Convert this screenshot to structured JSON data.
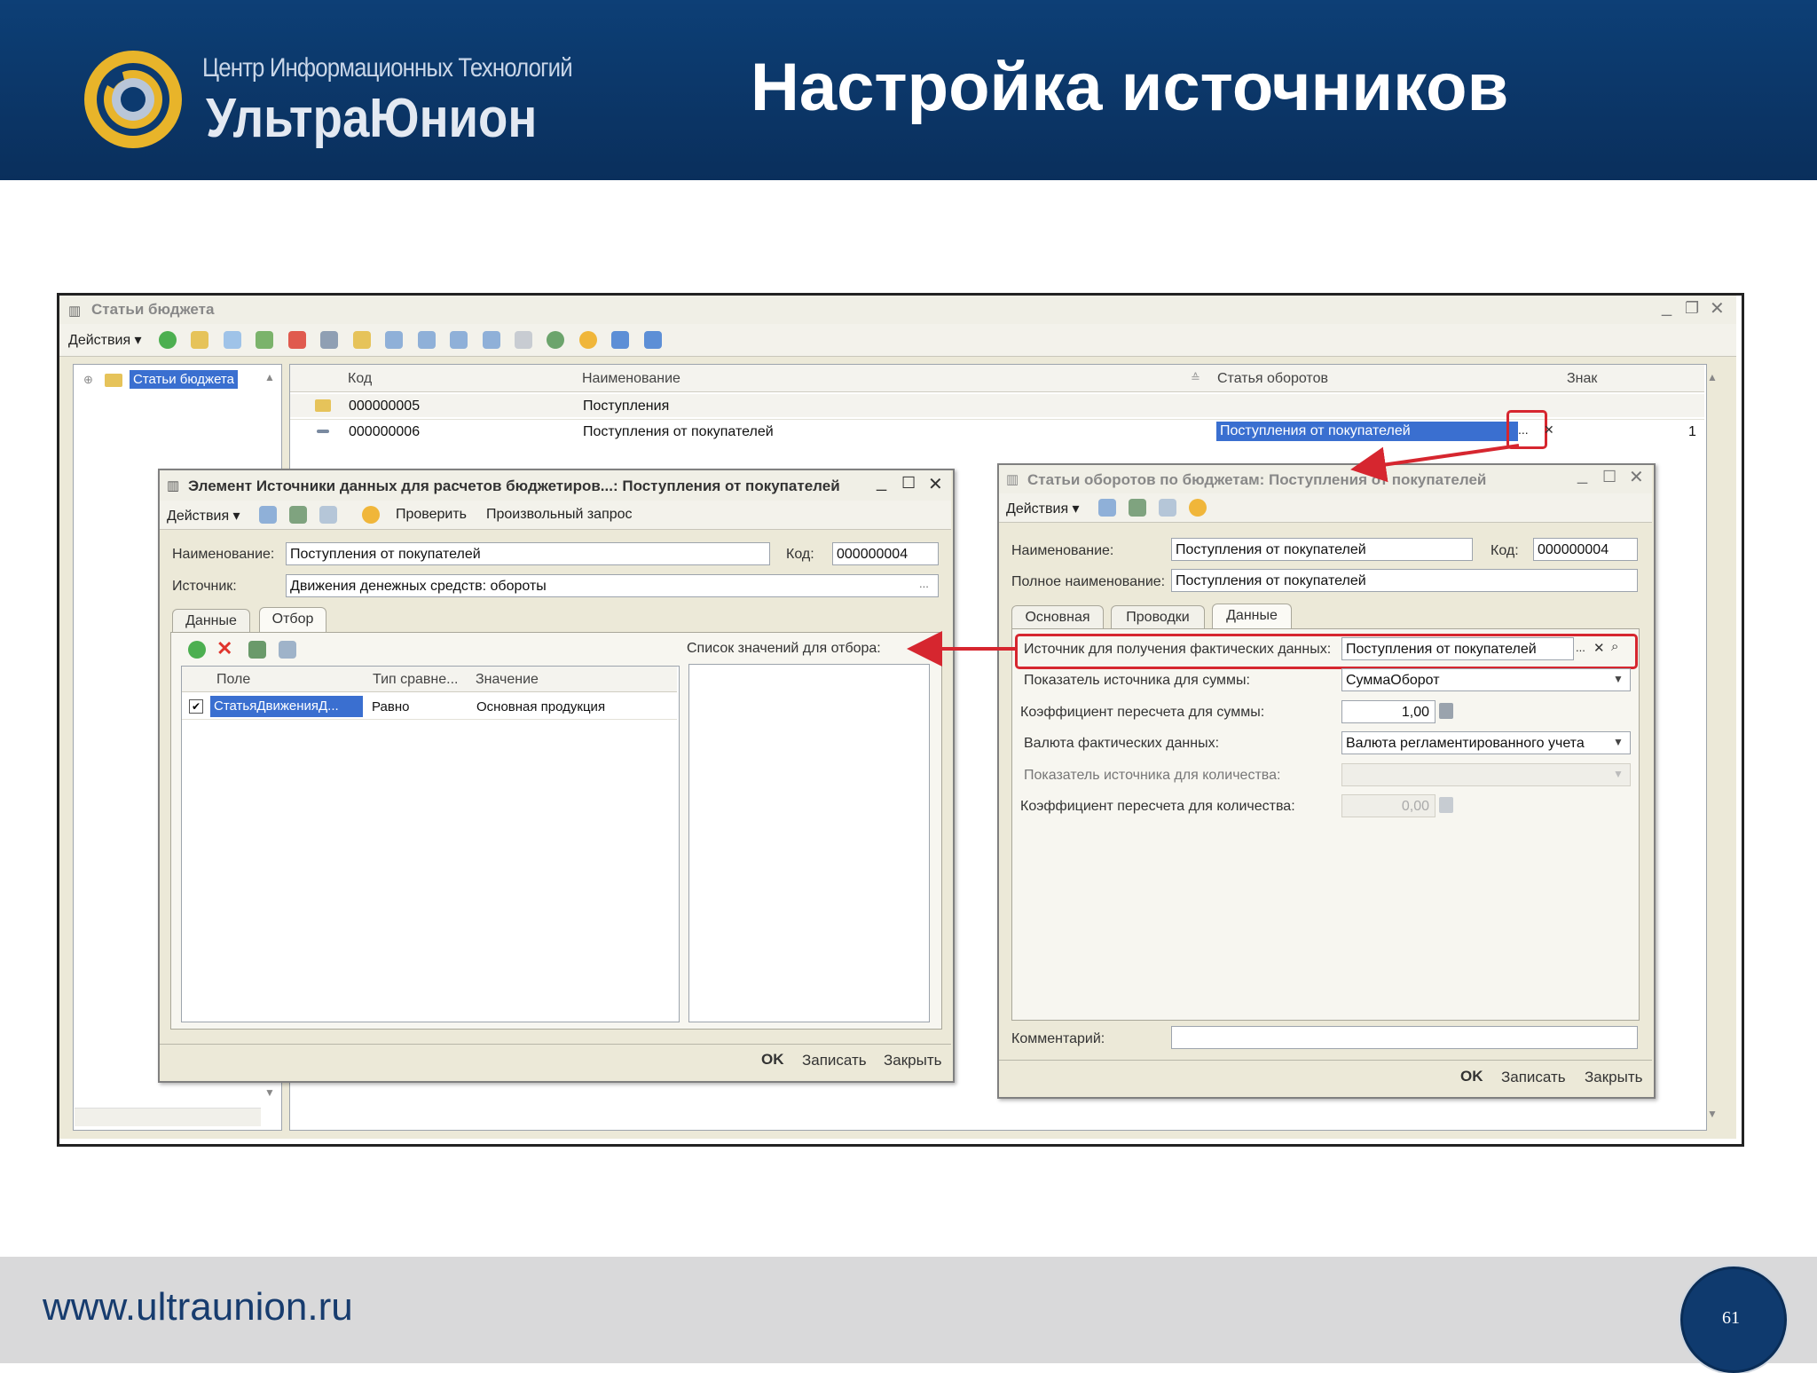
{
  "slide": {
    "logo_line1": "Центр Информационных Технологий",
    "logo_line2": "УльтраЮнион",
    "title": "Настройка источников",
    "footer_url": "www.ultraunion.ru",
    "page_number": "61"
  },
  "colors": {
    "header_bg": "#0d3f76",
    "logo_gold": "#e8b42a",
    "highlight_red": "#d6262f",
    "selection_blue": "#3a6fd0"
  },
  "main_window": {
    "title": "Статьи бюджета",
    "actions_label": "Действия",
    "tree_root": "Статьи бюджета",
    "columns": [
      "Код",
      "Наименование",
      "Статья оборотов",
      "Знак"
    ],
    "rows": [
      {
        "code": "000000005",
        "name": "Поступления",
        "article": "",
        "sign": ""
      },
      {
        "code": "000000006",
        "name": "Поступления от покупателей",
        "article": "Поступления от покупателей",
        "sign": "1"
      }
    ],
    "ellipsis": "..."
  },
  "element_window": {
    "title": "Элемент Источники данных для расчетов бюджетиров...: Поступления от покупателей",
    "actions_label": "Действия",
    "check_label": "Проверить",
    "query_label": "Произвольный запрос",
    "name_label": "Наименование:",
    "name_value": "Поступления от покупателей",
    "code_label": "Код:",
    "code_value": "000000004",
    "source_label": "Источник:",
    "source_value": "Движения денежных средств: обороты",
    "tabs": [
      "Данные",
      "Отбор"
    ],
    "filter_columns": [
      "Поле",
      "Тип сравне...",
      "Значение"
    ],
    "filter_row": {
      "field": "СтатьяДвиженияД...",
      "comparison": "Равно",
      "value": "Основная продукция"
    },
    "values_list_label": "Список значений для отбора:",
    "ok": "OK",
    "save": "Записать",
    "close": "Закрыть"
  },
  "article_window": {
    "title": "Статьи оборотов по бюджетам: Поступления от покупателей",
    "actions_label": "Действия",
    "name_label": "Наименование:",
    "name_value": "Поступления от покупателей",
    "code_label": "Код:",
    "code_value": "000000004",
    "fullname_label": "Полное наименование:",
    "fullname_value": "Поступления от покупателей",
    "tabs": [
      "Основная",
      "Проводки",
      "Данные"
    ],
    "source_label": "Источник для получения фактических данных:",
    "source_value": "Поступления от покупателей",
    "sum_indicator_label": "Показатель источника для суммы:",
    "sum_indicator_value": "СуммаОборот",
    "sum_coef_label": "Коэффициент пересчета для суммы:",
    "sum_coef_value": "1,00",
    "currency_label": "Валюта фактических данных:",
    "currency_value": "Валюта регламентированного учета",
    "qty_indicator_label": "Показатель источника для количества:",
    "qty_coef_label": "Коэффициент пересчета для количества:",
    "qty_coef_value": "0,00",
    "comment_label": "Комментарий:",
    "ok": "OK",
    "save": "Записать",
    "close": "Закрыть"
  }
}
